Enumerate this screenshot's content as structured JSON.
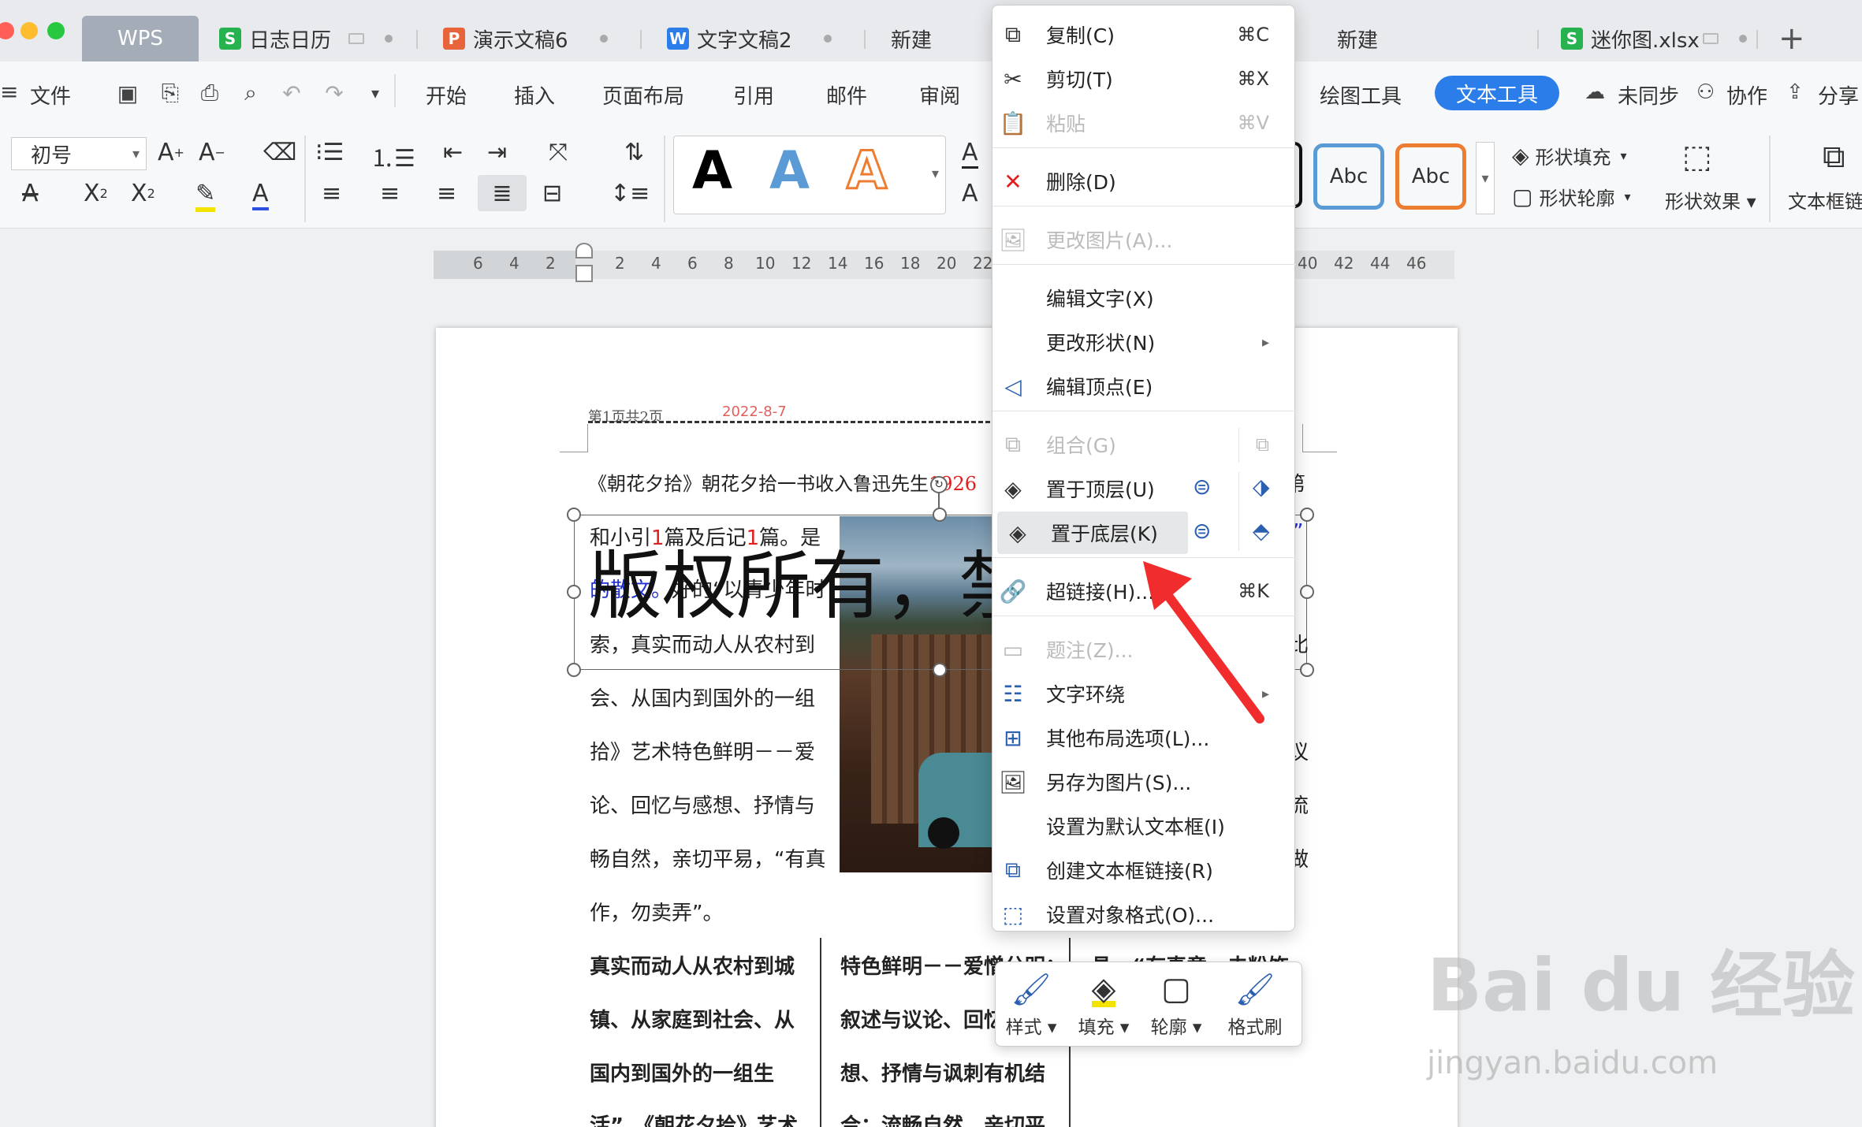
{
  "tabs": [
    {
      "label": "WPS"
    },
    {
      "label": "日志日历"
    },
    {
      "label": "演示文稿6"
    },
    {
      "label": "文字文稿2"
    },
    {
      "label": "新建"
    },
    {
      "label": "新建"
    },
    {
      "label": "迷你图.xlsx"
    }
  ],
  "menu": {
    "file": "文件",
    "items": [
      "开始",
      "插入",
      "页面布局",
      "引用",
      "邮件",
      "审阅"
    ],
    "right": [
      "绘图工具",
      "文本工具",
      "未同步",
      "协作",
      "分享"
    ]
  },
  "ribbon": {
    "font_size": "初号",
    "style_samples": [
      "A",
      "A",
      "A"
    ],
    "shape_samples": [
      "Abc",
      "Abc"
    ],
    "shape_fill": "形状填充",
    "shape_outline": "形状轮廓",
    "shape_effect": "形状效果",
    "text_link": "文本框链"
  },
  "ruler": [
    "6",
    "4",
    "2",
    "2",
    "4",
    "6",
    "8",
    "10",
    "12",
    "14",
    "16",
    "18",
    "20",
    "22",
    "40",
    "42",
    "44",
    "46"
  ],
  "doc": {
    "header_left": "第1页共2页",
    "header_date": "2022-8-7",
    "intro": "《朝花夕拾》朝花夕拾一书收入鲁迅先生",
    "intro_year": "1926",
    "box_line1_a": "和小引",
    "box_line1_b": "1",
    "box_line1_c": "篇及后记",
    "box_line1_d": "1",
    "box_line1_e": "篇。是",
    "box_line2_a": "的散文。",
    "box_line2_b": "好的“以青少年时",
    "box_line3": "索，真实而动人从农村到",
    "watermark": "版权所有，禁",
    "lines": [
      "会、从国内到国外的一组",
      "拾》艺术特色鲜明－－爱",
      "论、回忆与感想、抒情与",
      "畅自然，亲切平易，“有真",
      "作，勿卖弄”。"
    ],
    "col1": [
      "真实而动人从农村到城",
      "镇、从家庭到社会、从",
      "国内到国外的一组生",
      "活”。《朝花夕拾》艺术"
    ],
    "col2": [
      "特色鲜明－－爱憎分明；",
      "叙述与议论、回忆",
      "想、抒情与讽刺有机结",
      "合；流畅自然，亲切平"
    ],
    "col3_top": "具，“有真意，去粉饰",
    "right_chars": [
      "第",
      "”",
      "比",
      "议",
      "流",
      "做"
    ]
  },
  "context_menu": [
    {
      "icon": "copy",
      "label": "复制(C)",
      "shortcut": "⌘C",
      "disabled": false
    },
    {
      "icon": "cut",
      "label": "剪切(T)",
      "shortcut": "⌘X",
      "disabled": false
    },
    {
      "icon": "paste",
      "label": "粘贴",
      "shortcut": "⌘V",
      "disabled": true
    },
    {
      "icon": "delete",
      "label": "删除(D)",
      "shortcut": "",
      "disabled": false
    },
    {
      "icon": "image",
      "label": "更改图片(A)...",
      "shortcut": "",
      "disabled": true
    },
    {
      "icon": "",
      "label": "编辑文字(X)",
      "shortcut": "",
      "disabled": false
    },
    {
      "icon": "",
      "label": "更改形状(N)",
      "shortcut": "▸",
      "disabled": false
    },
    {
      "icon": "vertex",
      "label": "编辑顶点(E)",
      "shortcut": "",
      "disabled": false
    },
    {
      "icon": "group",
      "label": "组合(G)",
      "shortcut": "",
      "disabled": true
    },
    {
      "icon": "layers",
      "label": "置于顶层(U)",
      "shortcut": "",
      "disabled": false
    },
    {
      "icon": "layers",
      "label": "置于底层(K)",
      "shortcut": "",
      "disabled": false
    },
    {
      "icon": "link",
      "label": "超链接(H)...",
      "shortcut": "⌘K",
      "disabled": false
    },
    {
      "icon": "caption",
      "label": "题注(Z)...",
      "shortcut": "",
      "disabled": true
    },
    {
      "icon": "wrap",
      "label": "文字环绕",
      "shortcut": "▸",
      "disabled": false
    },
    {
      "icon": "layout",
      "label": "其他布局选项(L)...",
      "shortcut": "",
      "disabled": false
    },
    {
      "icon": "save-image",
      "label": "另存为图片(S)...",
      "shortcut": "",
      "disabled": false
    },
    {
      "icon": "",
      "label": "设置为默认文本框(I)",
      "shortcut": "",
      "disabled": false
    },
    {
      "icon": "textlink",
      "label": "创建文本框链接(R)",
      "shortcut": "",
      "disabled": false
    },
    {
      "icon": "format",
      "label": "设置对象格式(O)...",
      "shortcut": "",
      "disabled": false
    }
  ],
  "float_toolbar": [
    "样式",
    "填充",
    "轮廓",
    "格式刷"
  ],
  "watermark": {
    "logo": "Bai du 经验",
    "url": "jingyan.baidu.com"
  },
  "colors": {
    "accent": "#2b7de9",
    "wps_red": "#e4393c",
    "green": "#26b24f",
    "arrow": "#f02c2c"
  }
}
